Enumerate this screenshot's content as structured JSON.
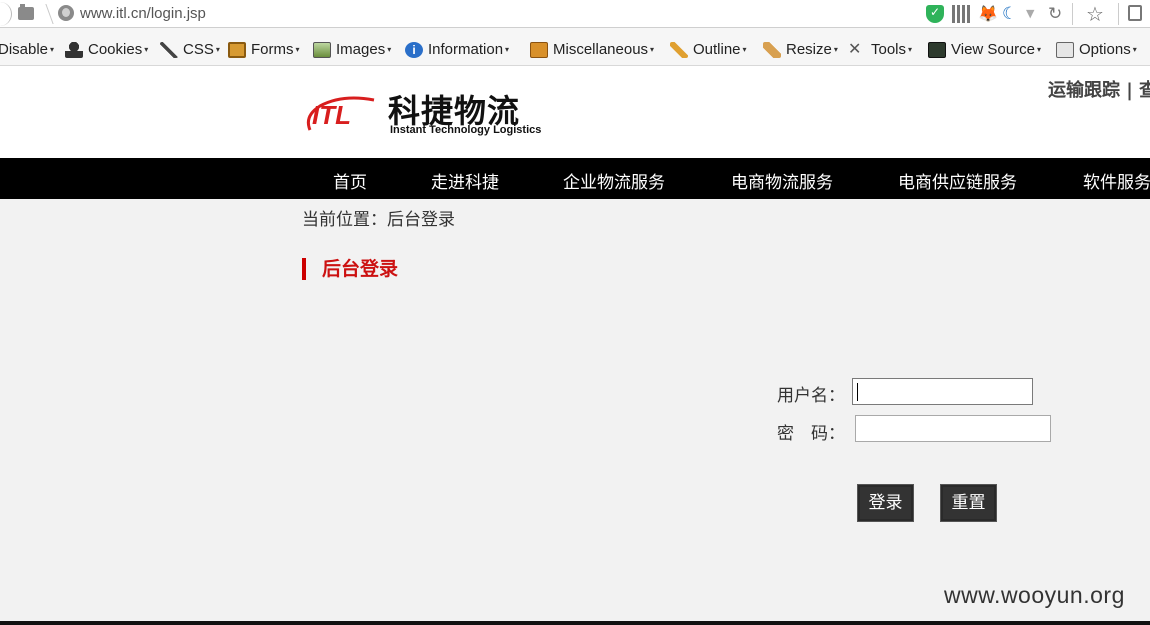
{
  "browser": {
    "url": "www.itl.cn/login.jsp"
  },
  "devtoolbar": {
    "items": [
      {
        "label": "Disable",
        "icon": "disable-icon"
      },
      {
        "label": "Cookies",
        "icon": "cookies-icon"
      },
      {
        "label": "CSS",
        "icon": "css-wand-icon"
      },
      {
        "label": "Forms",
        "icon": "forms-clipboard-icon"
      },
      {
        "label": "Images",
        "icon": "images-icon"
      },
      {
        "label": "Information",
        "icon": "information-icon"
      },
      {
        "label": "Miscellaneous",
        "icon": "miscellaneous-icon"
      },
      {
        "label": "Outline",
        "icon": "outline-pencil-icon"
      },
      {
        "label": "Resize",
        "icon": "resize-ruler-icon"
      },
      {
        "label": "Tools",
        "icon": "tools-icon"
      },
      {
        "label": "View Source",
        "icon": "view-source-icon"
      },
      {
        "label": "Options",
        "icon": "options-icon"
      }
    ]
  },
  "header": {
    "logo_mark": "ITL",
    "logo_cn": "科捷物流",
    "logo_en": "Instant Technology Logistics",
    "toplinks": "运输跟踪 | 查"
  },
  "nav": {
    "items": [
      "首页",
      "走进科捷",
      "企业物流服务",
      "电商物流服务",
      "电商供应链服务",
      "软件服务"
    ]
  },
  "main": {
    "breadcrumb": "当前位置：后台登录",
    "section_title": "后台登录",
    "username_label": "用户名：",
    "username_value": "",
    "password_label": "密　码：",
    "password_value": "",
    "login_button": "登录",
    "reset_button": "重置"
  },
  "watermark": "www.wooyun.org",
  "colors": {
    "accent_red": "#cc1111",
    "nav_bg": "#000000",
    "button_bg": "#333333",
    "page_bg": "#f2f2f2"
  }
}
